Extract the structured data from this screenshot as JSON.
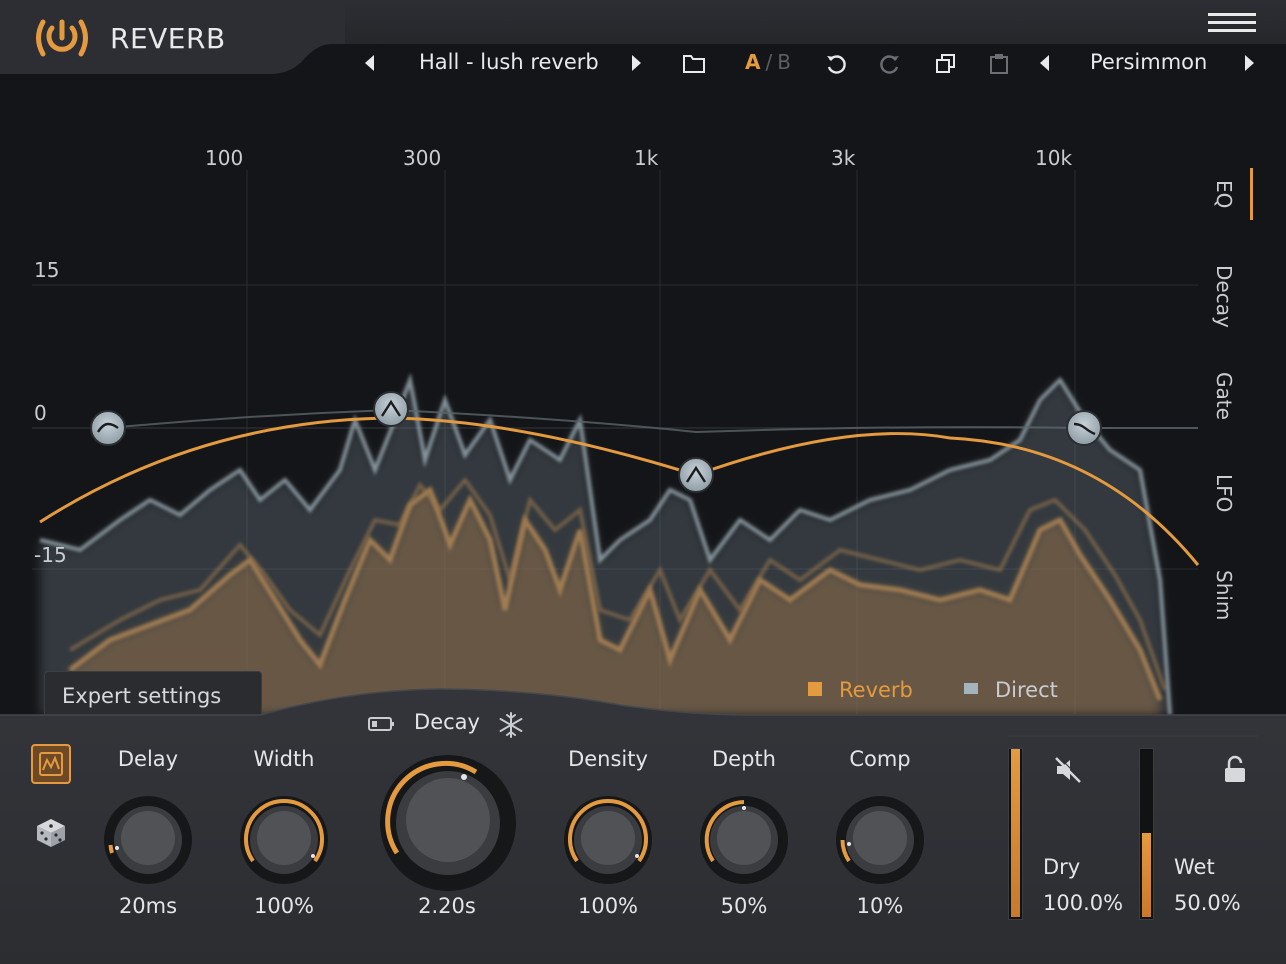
{
  "app": {
    "title": "REVERB",
    "accent": "#e49a3f",
    "menu_icon": "hamburger-menu-icon"
  },
  "toolbar": {
    "preset_name": "Hall - lush reverb",
    "ab_a": "A",
    "ab_sep": "/",
    "ab_b": "B",
    "theme_name": "Persimmon"
  },
  "graph": {
    "freq_labels": [
      "100",
      "300",
      "1k",
      "3k",
      "10k"
    ],
    "db_labels": [
      "15",
      "0",
      "-15"
    ],
    "side_tabs": [
      "EQ",
      "Decay",
      "Gate",
      "LFO",
      "Shim"
    ],
    "active_tab": "EQ",
    "legend": {
      "reverb": "Reverb",
      "direct": "Direct"
    },
    "reverb_color": "#e49a3f",
    "direct_color": "#8fa3ad"
  },
  "expert_settings": "Expert settings",
  "controls": {
    "delay": {
      "label": "Delay",
      "value": "20ms"
    },
    "width": {
      "label": "Width",
      "value": "100%"
    },
    "decay": {
      "label": "Decay",
      "value": "2.20s"
    },
    "density": {
      "label": "Density",
      "value": "100%"
    },
    "depth": {
      "label": "Depth",
      "value": "50%"
    },
    "comp": {
      "label": "Comp",
      "value": "10%"
    }
  },
  "mix": {
    "dry": {
      "label": "Dry",
      "value": "100.0%",
      "level": 1.0
    },
    "wet": {
      "label": "Wet",
      "value": "50.0%",
      "level": 0.5
    }
  }
}
